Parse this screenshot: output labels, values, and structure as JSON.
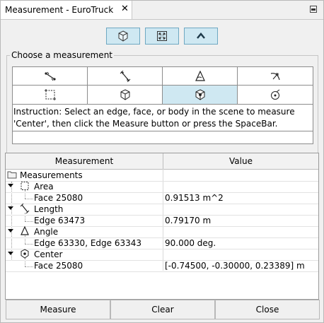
{
  "tab": {
    "title": "Measurement - EuroTruck",
    "close_glyph": "✕"
  },
  "toolbar": {
    "icons": [
      "box-icon",
      "fit-view-icon",
      "collapse-up-icon"
    ]
  },
  "choose": {
    "legend": "Choose a measurement",
    "tools": [
      {
        "name": "point-to-point-icon",
        "selected": false
      },
      {
        "name": "edge-length-icon",
        "selected": false
      },
      {
        "name": "angle-icon",
        "selected": false
      },
      {
        "name": "radius-icon",
        "selected": false
      },
      {
        "name": "area-icon",
        "selected": false
      },
      {
        "name": "volume-icon",
        "selected": false
      },
      {
        "name": "center-icon",
        "selected": true
      },
      {
        "name": "circle-center-icon",
        "selected": false
      }
    ],
    "instruction": "Instruction: Select an edge, face, or body in the scene to measure 'Center', then click the Measure button or press the SpaceBar."
  },
  "table": {
    "headers": {
      "measurement": "Measurement",
      "value": "Value"
    },
    "root": "Measurements",
    "groups": [
      {
        "label": "Area",
        "icon": "area-icon",
        "item": "Face 25080",
        "value": "0.91513 m^2"
      },
      {
        "label": "Length",
        "icon": "edge-length-icon",
        "item": "Edge 63473",
        "value": "0.79170 m"
      },
      {
        "label": "Angle",
        "icon": "angle-icon",
        "item": "Edge 63330, Edge 63343",
        "value": "90.000 deg."
      },
      {
        "label": "Center",
        "icon": "center-icon",
        "item": "Face 25080",
        "value": "[-0.74500, -0.30000, 0.23389] m"
      }
    ]
  },
  "buttons": {
    "measure": "Measure",
    "clear": "Clear",
    "close": "Close"
  },
  "colors": {
    "selected_bg": "#cfe8f2",
    "selected_border": "#6fa8c2"
  }
}
